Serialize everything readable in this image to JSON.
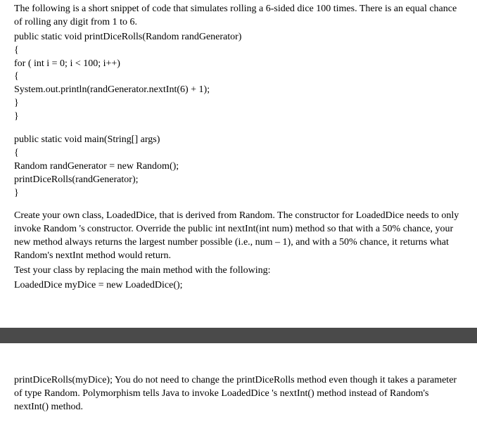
{
  "section1": {
    "intro": "The following is a short snippet of code that simulates rolling a 6-sided dice 100 times. There is an equal chance of rolling any digit from 1 to 6.",
    "code": [
      "public static void printDiceRolls(Random randGenerator)",
      "{",
      "for ( int i = 0; i < 100; i++)",
      "{",
      "System.out.println(randGenerator.nextInt(6) + 1);",
      "}",
      "}"
    ],
    "main_code": [
      "public static void main(String[] args)",
      "{",
      "Random randGenerator = new Random();",
      "printDiceRolls(randGenerator);",
      "}"
    ],
    "instructions": "Create your own class, LoadedDice, that is derived from Random. The constructor for LoadedDice needs to only invoke Random 's constructor. Override the public int nextInt(int num) method so that with a 50% chance, your new method always returns the largest number possible (i.e., num – 1), and with a 50% chance, it returns what Random's nextInt method would return.",
    "test_line": "Test your class by replacing the main method with the following:",
    "test_code": "LoadedDice myDice = new LoadedDice();"
  },
  "section2": {
    "text": "printDiceRolls(myDice); You do not need to change the printDiceRolls method even though it takes a parameter of type Random. Polymorphism tells Java to invoke LoadedDice 's nextInt() method instead of Random's nextInt() method."
  }
}
